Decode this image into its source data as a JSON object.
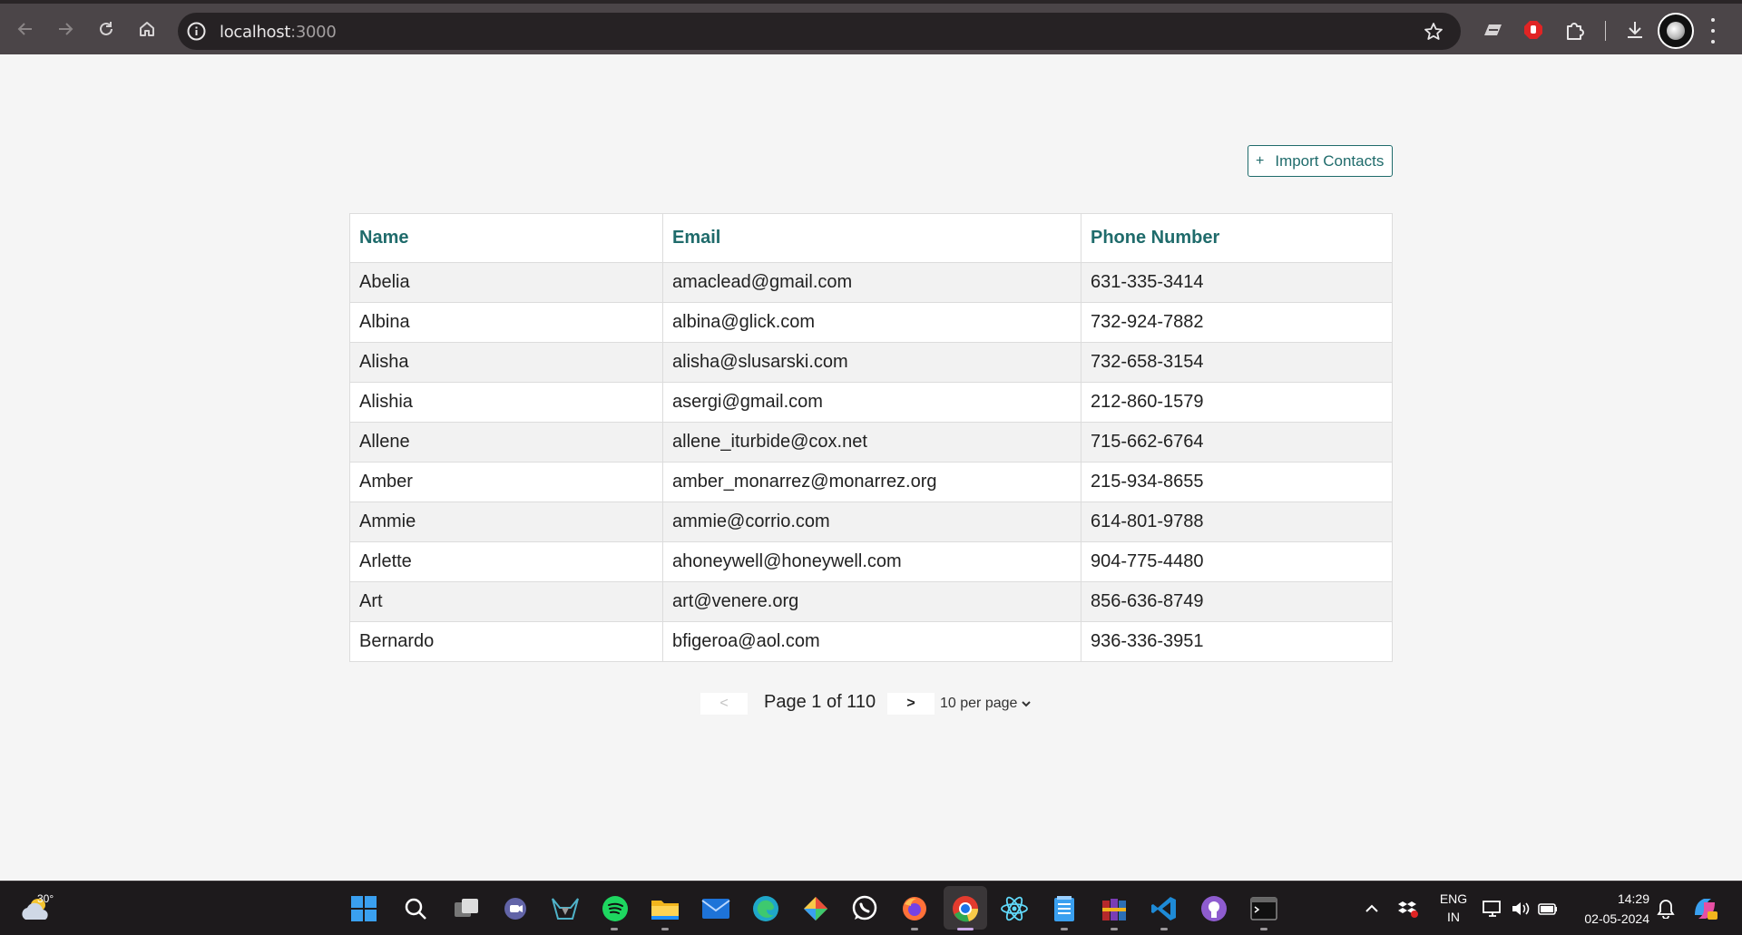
{
  "browser": {
    "address_host": "localhost",
    "address_port": ":3000"
  },
  "page": {
    "import_button_icon": "+",
    "import_button_label": "Import Contacts",
    "table": {
      "headers": [
        "Name",
        "Email",
        "Phone Number"
      ],
      "rows": [
        [
          "Abelia",
          "amaclead@gmail.com",
          "631-335-3414"
        ],
        [
          "Albina",
          "albina@glick.com",
          "732-924-7882"
        ],
        [
          "Alisha",
          "alisha@slusarski.com",
          "732-658-3154"
        ],
        [
          "Alishia",
          "asergi@gmail.com",
          "212-860-1579"
        ],
        [
          "Allene",
          "allene_iturbide@cox.net",
          "715-662-6764"
        ],
        [
          "Amber",
          "amber_monarrez@monarrez.org",
          "215-934-8655"
        ],
        [
          "Ammie",
          "ammie@corrio.com",
          "614-801-9788"
        ],
        [
          "Arlette",
          "ahoneywell@honeywell.com",
          "904-775-4480"
        ],
        [
          "Art",
          "art@venere.org",
          "856-636-8749"
        ],
        [
          "Bernardo",
          "bfigeroa@aol.com",
          "936-336-3951"
        ]
      ]
    },
    "pagination": {
      "prev_label": "<",
      "next_label": ">",
      "page_text": "Page 1 of 110",
      "per_page_value": "10 per page"
    }
  },
  "taskbar": {
    "weather_temp": "30°",
    "language_line1": "ENG",
    "language_line2": "IN",
    "time": "14:29",
    "date": "02-05-2024",
    "apps": [
      "start",
      "search",
      "task-view",
      "teams-chat",
      "predator",
      "spotify",
      "file-explorer",
      "mail",
      "edge",
      "git",
      "whatsapp",
      "firefox",
      "chrome",
      "react",
      "notepad",
      "winrar",
      "vscode",
      "github",
      "terminal"
    ]
  },
  "colors": {
    "accent": "#1f6b6b",
    "row_alt": "#f2f2f2",
    "page_bg": "#f5f5f5",
    "chrome_bg": "#4b4548",
    "taskbar_bg": "#1d1a1c"
  }
}
